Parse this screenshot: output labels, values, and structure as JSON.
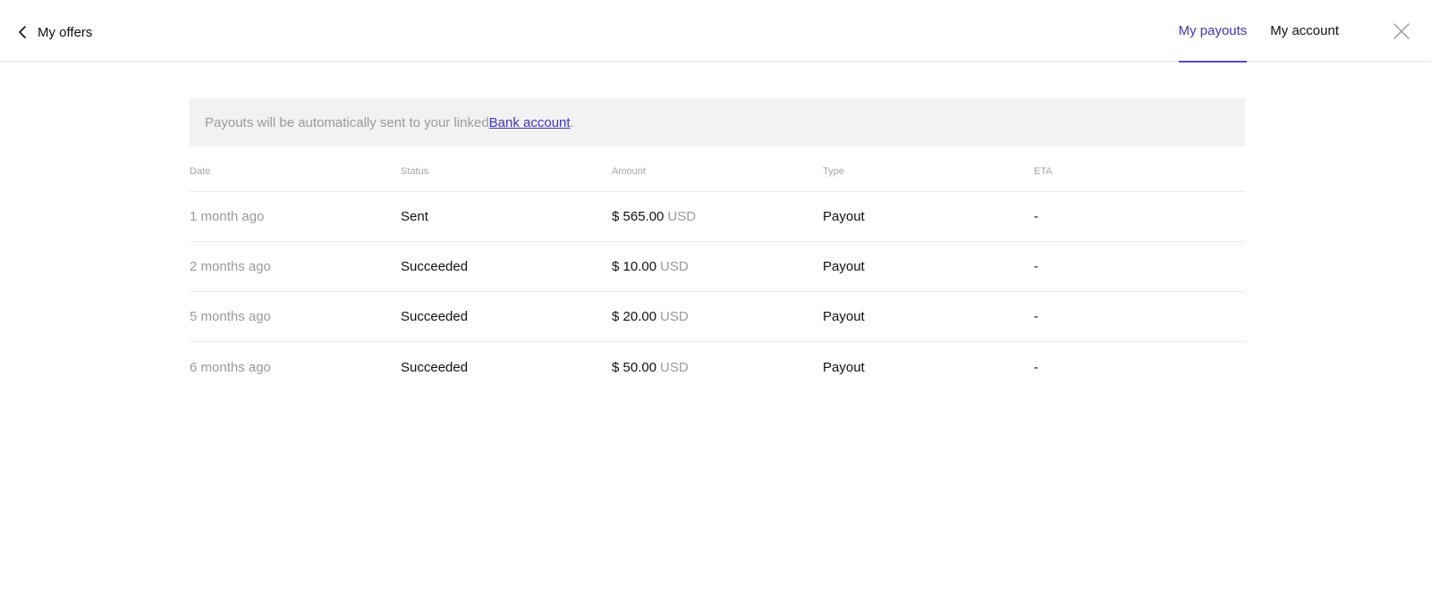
{
  "header": {
    "back_label": "My offers",
    "tabs": [
      {
        "label": "My payouts",
        "active": true
      },
      {
        "label": "My account",
        "active": false
      }
    ],
    "close_icon": "close-icon",
    "accent_color": "#3d35c2"
  },
  "banner": {
    "text_before": "Payouts will be automatically sent to your linked ",
    "link_text": "Bank account",
    "text_after": "."
  },
  "table": {
    "columns": [
      "Date",
      "Status",
      "Amount",
      "Type",
      "ETA"
    ],
    "rows": [
      {
        "date": "1 month ago",
        "status": "Sent",
        "amount": "$ 565.00",
        "currency": "USD",
        "type": "Payout",
        "eta": "-"
      },
      {
        "date": "2 months ago",
        "status": "Succeeded",
        "amount": "$ 10.00",
        "currency": "USD",
        "type": "Payout",
        "eta": "-"
      },
      {
        "date": "5 months ago",
        "status": "Succeeded",
        "amount": "$ 20.00",
        "currency": "USD",
        "type": "Payout",
        "eta": "-"
      },
      {
        "date": "6 months ago",
        "status": "Succeeded",
        "amount": "$ 50.00",
        "currency": "USD",
        "type": "Payout",
        "eta": "-"
      }
    ]
  }
}
